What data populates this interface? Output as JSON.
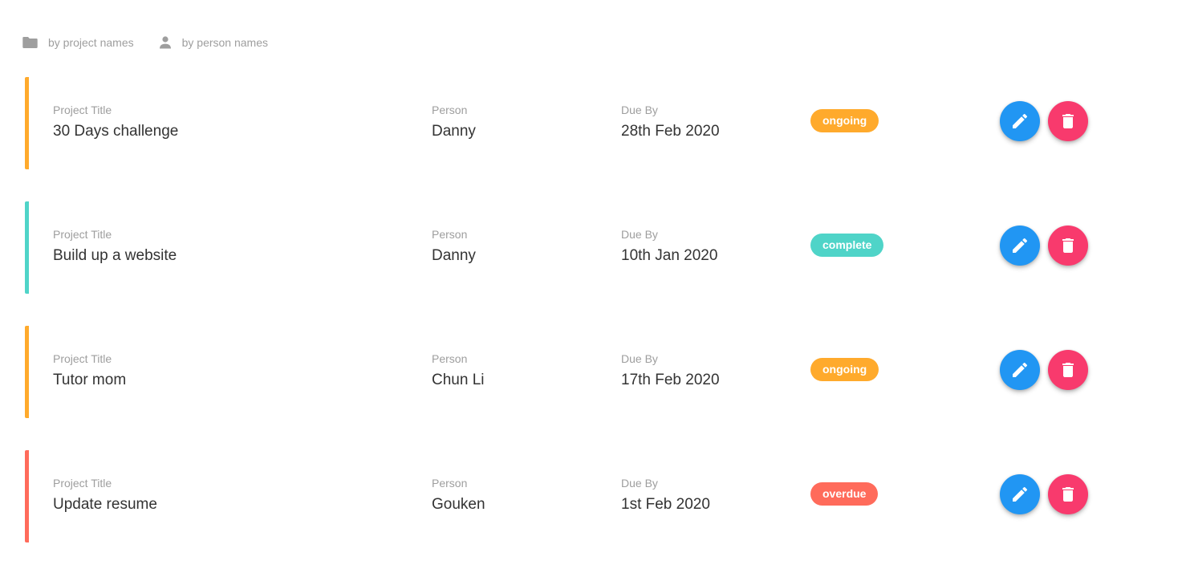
{
  "toolbar": {
    "sort_by_project": {
      "label": "by project names",
      "icon": "folder-icon"
    },
    "sort_by_person": {
      "label": "by person names",
      "icon": "person-icon"
    }
  },
  "colors": {
    "ongoing": "#ffaa2c",
    "complete": "#4fd4c8",
    "overdue": "#ff6b5b",
    "edit": "#2196f3",
    "delete": "#f83a6d"
  },
  "projects": [
    {
      "title_label": "Project Title",
      "title": "30 Days challenge",
      "person_label": "Person",
      "person": "Danny",
      "due_label": "Due By",
      "due": "28th Feb 2020",
      "status": "ongoing",
      "color": "#ffaa2c"
    },
    {
      "title_label": "Project Title",
      "title": "Build up a website",
      "person_label": "Person",
      "person": "Danny",
      "due_label": "Due By",
      "due": "10th Jan 2020",
      "status": "complete",
      "color": "#4fd4c8"
    },
    {
      "title_label": "Project Title",
      "title": "Tutor mom",
      "person_label": "Person",
      "person": "Chun Li",
      "due_label": "Due By",
      "due": "17th Feb 2020",
      "status": "ongoing",
      "color": "#ffaa2c"
    },
    {
      "title_label": "Project Title",
      "title": "Update resume",
      "person_label": "Person",
      "person": "Gouken",
      "due_label": "Due By",
      "due": "1st Feb 2020",
      "status": "overdue",
      "color": "#ff6b5b"
    }
  ]
}
